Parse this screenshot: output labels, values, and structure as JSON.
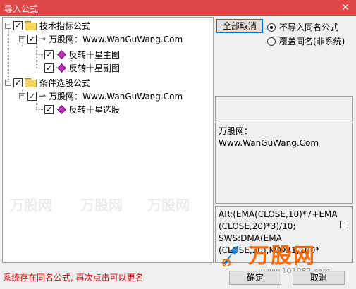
{
  "window": {
    "title": "导入公式",
    "close_glyph": "✕"
  },
  "tree": {
    "groups": [
      {
        "label": "技术指标公式",
        "checked": true,
        "source": "万股网：Www.WanGuWang.Com",
        "items": [
          "反转十星主图",
          "反转十星副图"
        ]
      },
      {
        "label": "条件选股公式",
        "checked": true,
        "source": "万股网：Www.WanGuWang.Com",
        "items": [
          "反转十星选股"
        ]
      }
    ]
  },
  "options": {
    "cancel_all_label": "全部取消",
    "radio_skip_label": "不导入同名公式",
    "radio_overwrite_label": "覆盖同名(非系统)",
    "selected": "skip"
  },
  "info": {
    "source_line1": "万股网：",
    "source_line2": "Www.WanGuWang.Com"
  },
  "formula": {
    "line1": "AR:(EMA(CLOSE,10)*7+EMA",
    "line2": "(CLOSE,20)*3)/10;",
    "line3": "SWS:DMA(EMA",
    "line4": "(CLOSE,20),MAX(1,100*"
  },
  "status_text": "系统存在同名公式, 再次点击可以更名",
  "buttons": {
    "ok_label": "确定",
    "cancel_label": "取消"
  },
  "watermark": {
    "brand": "万股网",
    "url": "www.101082.com"
  }
}
